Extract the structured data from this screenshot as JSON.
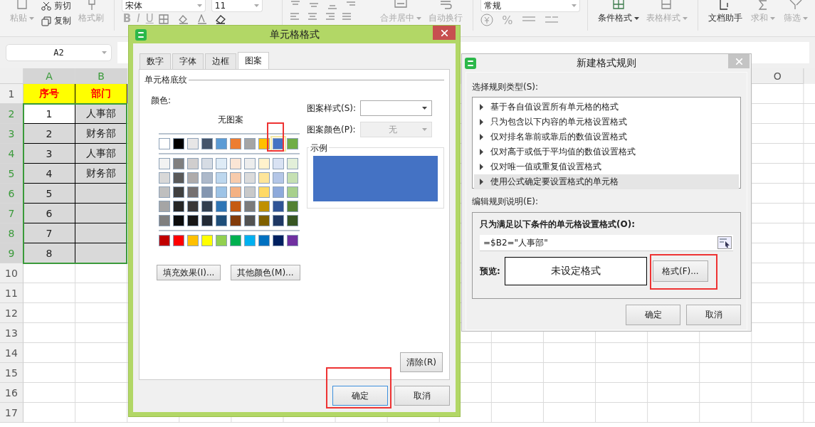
{
  "ribbon": {
    "paste": {
      "label": "粘贴",
      "disabled": true,
      "dropdown": true
    },
    "cut": {
      "label": "剪切",
      "disabled": false
    },
    "copy": {
      "label": "复制",
      "disabled": false
    },
    "format_painter": {
      "label": "格式刷",
      "disabled": true
    },
    "font_name": "宋体",
    "font_size": "11",
    "style_buttons": [
      "B",
      "I",
      "U"
    ],
    "align_buttons": [
      {
        "label": "合并居中",
        "disabled": true,
        "dropdown": true
      },
      {
        "label": "自动换行",
        "disabled": true,
        "dropdown": false
      }
    ],
    "number_format": "常规",
    "number_buttons": [
      "%"
    ],
    "tool_buttons": [
      {
        "label": "条件格式",
        "disabled": false,
        "dropdown": true
      },
      {
        "label": "表格样式",
        "disabled": true,
        "dropdown": true
      }
    ],
    "assist_buttons": [
      {
        "label": "文档助手",
        "disabled": false,
        "dropdown": false
      },
      {
        "label": "求和",
        "disabled": true,
        "dropdown": true
      },
      {
        "label": "筛选",
        "disabled": true,
        "dropdown": true
      }
    ]
  },
  "name_box": "A2",
  "sheet": {
    "columns": [
      {
        "label": "A",
        "selected": true
      },
      {
        "label": "B",
        "selected": true
      },
      {
        "label": "O",
        "selected": false
      }
    ],
    "rows": [
      {
        "header": "1",
        "selected": false,
        "cells": [
          {
            "text": "序号",
            "kind": "title"
          },
          {
            "text": "部门",
            "kind": "title"
          }
        ]
      },
      {
        "header": "2",
        "selected": true,
        "cells": [
          {
            "text": "1",
            "kind": "active"
          },
          {
            "text": "人事部",
            "kind": "selected"
          }
        ]
      },
      {
        "header": "3",
        "selected": true,
        "cells": [
          {
            "text": "2",
            "kind": "selected"
          },
          {
            "text": "财务部",
            "kind": "selected"
          }
        ]
      },
      {
        "header": "4",
        "selected": true,
        "cells": [
          {
            "text": "3",
            "kind": "selected"
          },
          {
            "text": "人事部",
            "kind": "selected"
          }
        ]
      },
      {
        "header": "5",
        "selected": true,
        "cells": [
          {
            "text": "4",
            "kind": "selected"
          },
          {
            "text": "财务部",
            "kind": "selected"
          }
        ]
      },
      {
        "header": "6",
        "selected": true,
        "cells": [
          {
            "text": "5",
            "kind": "selected"
          },
          {
            "kind": "selected"
          }
        ]
      },
      {
        "header": "7",
        "selected": true,
        "cells": [
          {
            "text": "6",
            "kind": "selected"
          },
          {
            "kind": "selected"
          }
        ]
      },
      {
        "header": "8",
        "selected": true,
        "cells": [
          {
            "text": "7",
            "kind": "selected"
          },
          {
            "kind": "selected"
          }
        ]
      },
      {
        "header": "9",
        "selected": true,
        "cells": [
          {
            "text": "8",
            "kind": "selected"
          },
          {
            "kind": "selected"
          }
        ]
      },
      {
        "header": "10",
        "selected": false
      },
      {
        "header": "11",
        "selected": false
      },
      {
        "header": "12",
        "selected": false
      },
      {
        "header": "13",
        "selected": false
      },
      {
        "header": "14",
        "selected": false
      },
      {
        "header": "15",
        "selected": false
      },
      {
        "header": "16",
        "selected": false
      },
      {
        "header": "17",
        "selected": false
      }
    ]
  },
  "format_dialog": {
    "title": "单元格格式",
    "tabs": [
      {
        "label": "数字",
        "selected": false
      },
      {
        "label": "字体",
        "selected": false
      },
      {
        "label": "边框",
        "selected": false
      },
      {
        "label": "图案",
        "selected": true
      }
    ],
    "section_title": "单元格底纹",
    "color_label": "颜色:",
    "no_pattern": "无图案",
    "swatch_highlighted": true,
    "theme_colors": [
      [
        {
          "color": "#ffffff",
          "selected": false
        },
        {
          "color": "#000000",
          "selected": false
        },
        {
          "color": "#e7e6e6",
          "selected": false
        },
        {
          "color": "#44546a",
          "selected": false
        },
        {
          "color": "#5b9bd5",
          "selected": false
        },
        {
          "color": "#ed7d31",
          "selected": false
        },
        {
          "color": "#a5a5a5",
          "selected": false
        },
        {
          "color": "#ffc000",
          "selected": false
        },
        {
          "color": "#4472c4",
          "selected": true
        },
        {
          "color": "#70ad47",
          "selected": false
        }
      ],
      [
        {
          "color": "#f2f2f2",
          "selected": false
        },
        {
          "color": "#7f7f7f",
          "selected": false
        },
        {
          "color": "#d0cece",
          "selected": false
        },
        {
          "color": "#d6dce4",
          "selected": false
        },
        {
          "color": "#deebf6",
          "selected": false
        },
        {
          "color": "#fbe5d5",
          "selected": false
        },
        {
          "color": "#ededed",
          "selected": false
        },
        {
          "color": "#fff2cc",
          "selected": false
        },
        {
          "color": "#d9e2f3",
          "selected": false
        },
        {
          "color": "#e2efd9",
          "selected": false
        }
      ],
      [
        {
          "color": "#d8d8d8",
          "selected": false
        },
        {
          "color": "#595959",
          "selected": false
        },
        {
          "color": "#aeabab",
          "selected": false
        },
        {
          "color": "#adb9ca",
          "selected": false
        },
        {
          "color": "#bdd7ee",
          "selected": false
        },
        {
          "color": "#f7cbac",
          "selected": false
        },
        {
          "color": "#dbdbdb",
          "selected": false
        },
        {
          "color": "#fee599",
          "selected": false
        },
        {
          "color": "#b4c6e7",
          "selected": false
        },
        {
          "color": "#c5e0b3",
          "selected": false
        }
      ],
      [
        {
          "color": "#bfbfbf",
          "selected": false
        },
        {
          "color": "#3f3f3f",
          "selected": false
        },
        {
          "color": "#757070",
          "selected": false
        },
        {
          "color": "#8496b0",
          "selected": false
        },
        {
          "color": "#9dc3e6",
          "selected": false
        },
        {
          "color": "#f4b183",
          "selected": false
        },
        {
          "color": "#c9c9c9",
          "selected": false
        },
        {
          "color": "#ffd965",
          "selected": false
        },
        {
          "color": "#8eaadb",
          "selected": false
        },
        {
          "color": "#a8d08d",
          "selected": false
        }
      ],
      [
        {
          "color": "#a5a5a5",
          "selected": false
        },
        {
          "color": "#262626",
          "selected": false
        },
        {
          "color": "#3a3838",
          "selected": false
        },
        {
          "color": "#323f4f",
          "selected": false
        },
        {
          "color": "#2e75b5",
          "selected": false
        },
        {
          "color": "#c55a11",
          "selected": false
        },
        {
          "color": "#7b7b7b",
          "selected": false
        },
        {
          "color": "#bf9000",
          "selected": false
        },
        {
          "color": "#2f5496",
          "selected": false
        },
        {
          "color": "#538135",
          "selected": false
        }
      ],
      [
        {
          "color": "#7f7f7f",
          "selected": false
        },
        {
          "color": "#0c0c0c",
          "selected": false
        },
        {
          "color": "#171616",
          "selected": false
        },
        {
          "color": "#222a35",
          "selected": false
        },
        {
          "color": "#1e4e79",
          "selected": false
        },
        {
          "color": "#833c0b",
          "selected": false
        },
        {
          "color": "#525252",
          "selected": false
        },
        {
          "color": "#7f6000",
          "selected": false
        },
        {
          "color": "#1f3864",
          "selected": false
        },
        {
          "color": "#375623",
          "selected": false
        }
      ]
    ],
    "standard_colors": [
      {
        "color": "#c00000",
        "selected": false
      },
      {
        "color": "#ff0000",
        "selected": false
      },
      {
        "color": "#ffc000",
        "selected": false
      },
      {
        "color": "#ffff00",
        "selected": false
      },
      {
        "color": "#92d050",
        "selected": false
      },
      {
        "color": "#00b050",
        "selected": false
      },
      {
        "color": "#00b0f0",
        "selected": false
      },
      {
        "color": "#0070c0",
        "selected": false
      },
      {
        "color": "#002060",
        "selected": false
      },
      {
        "color": "#7030a0",
        "selected": false
      }
    ],
    "fill_effects_button": "填充效果(I)...",
    "more_colors_button": "其他颜色(M)...",
    "pattern_style_label": "图案样式(S):",
    "pattern_color": {
      "label": "图案颜色(P):",
      "value": "无",
      "disabled": true
    },
    "sample_label": "示例",
    "clear_button": "清除(R)",
    "ok_button": {
      "label": "确定",
      "highlighted": true
    },
    "cancel_button": "取消"
  },
  "rule_dialog": {
    "title": "新建格式规则",
    "type_label": "选择规则类型(S):",
    "rule_types": [
      {
        "label": "基于各自值设置所有单元格的格式",
        "selected": false
      },
      {
        "label": "只为包含以下内容的单元格设置格式",
        "selected": false
      },
      {
        "label": "仅对排名靠前或靠后的数值设置格式",
        "selected": false
      },
      {
        "label": "仅对高于或低于平均值的数值设置格式",
        "selected": false
      },
      {
        "label": "仅对唯一值或重复值设置格式",
        "selected": false
      },
      {
        "label": "使用公式确定要设置格式的单元格",
        "selected": true
      }
    ],
    "edit_label": "编辑规则说明(E):",
    "condition_label": "只为满足以下条件的单元格设置格式(O):",
    "formula": "=$B2=\"人事部\"",
    "preview_label": "预览:",
    "preview_text": "未设定格式",
    "format_button": {
      "label": "格式(F)...",
      "highlighted": true
    },
    "ok_button": "确定",
    "cancel_button": "取消"
  }
}
